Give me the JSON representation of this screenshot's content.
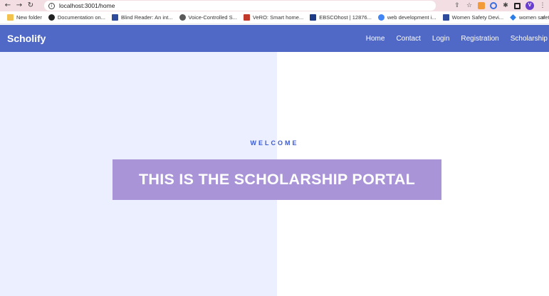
{
  "browser": {
    "url": "localhost:3001/home",
    "bookmarks": [
      {
        "label": "New folder",
        "color": "#f2c14e"
      },
      {
        "label": "Documentation on...",
        "color": "#222222"
      },
      {
        "label": "Blind Reader: An int...",
        "color": "#2f4b9b"
      },
      {
        "label": "Voice-Controlled S...",
        "color": "#5a5a5a"
      },
      {
        "label": "VeRO: Smart home...",
        "color": "#c0392b"
      },
      {
        "label": "EBSCOhost | 12876...",
        "color": "#1f3c88"
      },
      {
        "label": "web development i...",
        "color": "#4285f4"
      },
      {
        "label": "Women Safety Devi...",
        "color": "#2f4b9b"
      },
      {
        "label": "women safety secur...",
        "color": "#2b7de9"
      }
    ],
    "bookmarks_more": "»",
    "avatar_initial": "V"
  },
  "navbar": {
    "brand": "Scholify",
    "links": [
      "Home",
      "Contact",
      "Login",
      "Registration",
      "Scholarship"
    ],
    "color": "#5069c7"
  },
  "hero": {
    "welcome": "WELCOME",
    "title": "THIS IS THE SCHOLARSHIP PORTAL",
    "banner_color": "#a894d6",
    "left_bg": "#ebefff"
  }
}
